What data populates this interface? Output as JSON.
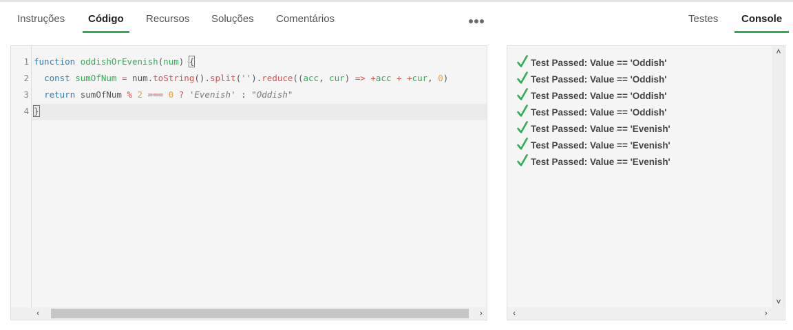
{
  "tabs": {
    "instructions": "Instruções",
    "code": "Código",
    "resources": "Recursos",
    "solutions": "Soluções",
    "comments": "Comentários"
  },
  "right_tabs": {
    "tests": "Testes",
    "console": "Console"
  },
  "editor": {
    "line_numbers": [
      "1",
      "2",
      "3",
      "4"
    ],
    "lines": [
      "function oddishOrEvenish(num) {",
      "  const sumOfNum = num.toString().split('').reduce((acc, cur) => +acc + +cur, 0)",
      "  return sumOfNum % 2 === 0 ? 'Evenish' : \"Oddish\"",
      "}"
    ]
  },
  "console": {
    "results": [
      "Test Passed: Value == 'Oddish'",
      "Test Passed: Value == 'Oddish'",
      "Test Passed: Value == 'Oddish'",
      "Test Passed: Value == 'Oddish'",
      "Test Passed: Value == 'Evenish'",
      "Test Passed: Value == 'Evenish'",
      "Test Passed: Value == 'Evenish'"
    ]
  },
  "colors": {
    "accent_green": "#2eaf55",
    "keyword_blue": "#2a7fbf",
    "property_red": "#e04d4d",
    "number_orange": "#e8a33b"
  },
  "icons": {
    "more": "more-horizontal-icon",
    "check": "check-icon",
    "scroll_left": "chevron-left-icon",
    "scroll_right": "chevron-right-icon",
    "scroll_up": "chevron-up-icon",
    "scroll_down": "chevron-down-icon"
  }
}
